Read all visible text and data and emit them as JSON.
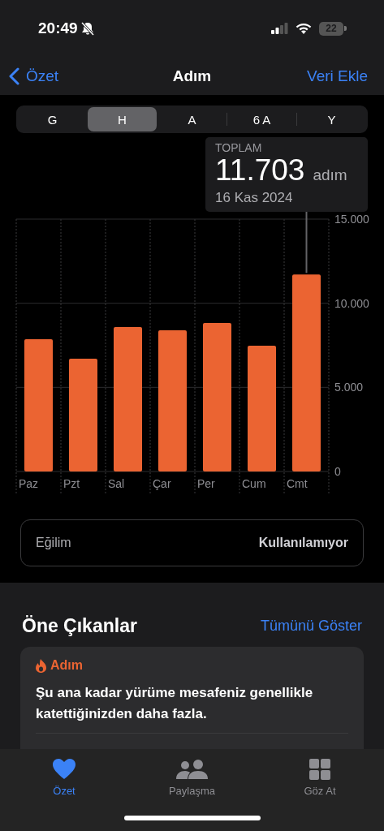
{
  "status_bar": {
    "time": "20:49",
    "silent": true,
    "battery": "22"
  },
  "nav": {
    "back": "Özet",
    "title": "Adım",
    "action": "Veri Ekle"
  },
  "ranges": [
    {
      "label": "G",
      "selected": false
    },
    {
      "label": "H",
      "selected": true
    },
    {
      "label": "A",
      "selected": false
    },
    {
      "label": "6 A",
      "selected": false
    },
    {
      "label": "Y",
      "selected": false
    }
  ],
  "summary": {
    "label": "TOPLAM",
    "value": "11.703",
    "unit": "adım",
    "date": "16 Kas 2024"
  },
  "chart": {
    "chart_data": {
      "type": "bar",
      "categories": [
        "Paz",
        "Pzt",
        "Sal",
        "Çar",
        "Per",
        "Cum",
        "Cmt"
      ],
      "values": [
        7860,
        6700,
        8590,
        8390,
        8830,
        7480,
        11703
      ],
      "ylim": [
        0,
        15000
      ],
      "yticks": [
        {
          "value": 0,
          "label": "0"
        },
        {
          "value": 5000,
          "label": "5.000"
        },
        {
          "value": 10000,
          "label": "10.000"
        },
        {
          "value": 15000,
          "label": "15.000"
        }
      ]
    }
  },
  "trend": {
    "label": "Eğilim",
    "value": "Kullanılamıyor"
  },
  "highlights": {
    "title": "Öne Çıkanlar",
    "link": "Tümünü Göster",
    "card": {
      "category": "Adım",
      "text": "Şu ana kadar yürüme mesafeniz genellikle katettiğinizden daha fazla."
    }
  },
  "tab_bar": [
    {
      "label": "Özet",
      "kind": "heart",
      "selected": true
    },
    {
      "label": "Paylaşma",
      "kind": "people",
      "selected": false
    },
    {
      "label": "Göz At",
      "kind": "grid",
      "selected": false
    }
  ]
}
